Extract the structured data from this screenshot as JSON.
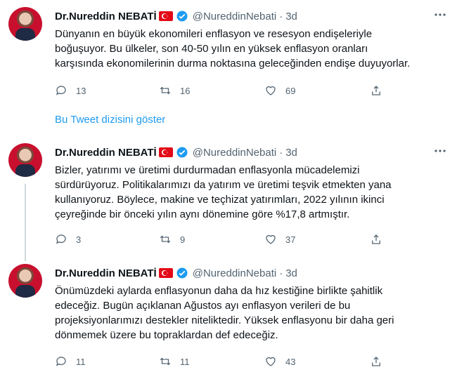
{
  "tweets": [
    {
      "name": "Dr.Nureddin NEBATİ",
      "handle": "@NureddinNebati",
      "time": "3d",
      "text": "Dünyanın en büyük ekonomileri enflasyon ve resesyon endişeleriyle\nboğuşuyor. Bu ülkeler, son 40-50 yılın en yüksek enflasyon oranları\nkarşısında ekonomilerinin durma noktasına geleceğinden endişe duyuyorlar.",
      "replies": "13",
      "retweets": "16",
      "likes": "69"
    },
    {
      "name": "Dr.Nureddin NEBATİ",
      "handle": "@NureddinNebati",
      "time": "3d",
      "text": "Bizler, yatırımı ve üretimi durdurmadan enflasyonla mücadelemizi\nsürdürüyoruz. Politikalarımızı da yatırım ve üretimi teşvik etmekten yana\nkullanıyoruz. Böylece, makine ve teçhizat yatırımları, 2022 yılının ikinci\nçeyreğinde bir önceki yılın aynı dönemine göre %17,8 artmıştır.",
      "replies": "3",
      "retweets": "9",
      "likes": "37"
    },
    {
      "name": "Dr.Nureddin NEBATİ",
      "handle": "@NureddinNebati",
      "time": "3d",
      "text": "Önümüzdeki aylarda enflasyonun daha da hız kestiğine birlikte şahitlik\nedeceğiz. Bugün açıklanan Ağustos ayı enflasyon verileri de bu\nprojeksiyonlarımızı destekler niteliktedir. Yüksek enflasyonu bir daha geri\ndönmemek üzere bu topraklardan def edeceğiz.",
      "replies": "11",
      "retweets": "11",
      "likes": "43"
    }
  ],
  "show_thread": "Bu Tweet dizisini göster",
  "dot": "·",
  "colors": {
    "accent": "#1d9bf0",
    "muted": "#536471",
    "flag": "#e30a17"
  }
}
